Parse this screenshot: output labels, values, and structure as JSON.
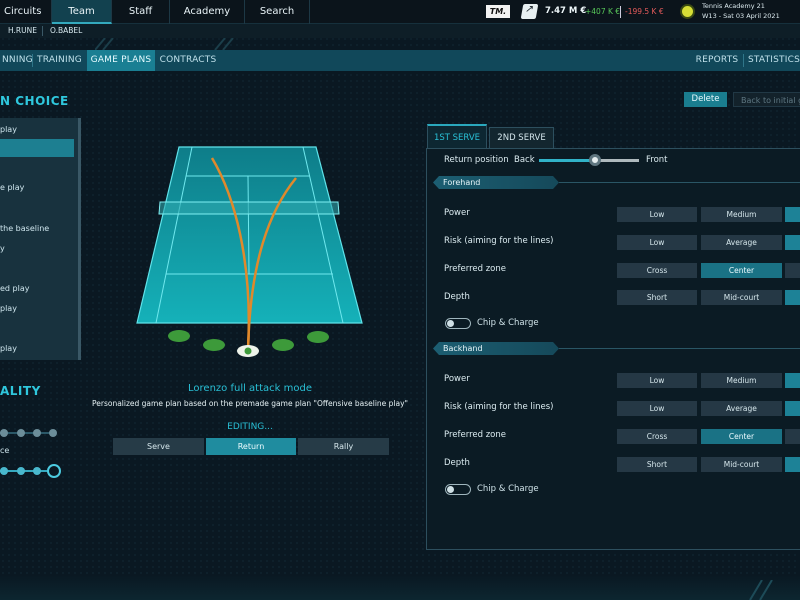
{
  "topnav": {
    "items": [
      "Circuits",
      "Team",
      "Staff",
      "Academy",
      "Search"
    ],
    "active": "Team",
    "tm_logo": "TM.",
    "balance": "7.47 M €",
    "income": "+407 K €",
    "expense": "-199.5 K €",
    "academy_name": "Tennis Academy 21",
    "date": "W13 - Sat 03 April 2021"
  },
  "players": [
    "H.RUNE",
    "O.BABEL"
  ],
  "tabs": {
    "left": [
      "NNING",
      "TRAINING",
      "GAME PLANS",
      "CONTRACTS"
    ],
    "right": [
      "REPORTS",
      "STATISTICS"
    ],
    "active": "GAME PLANS"
  },
  "left_section": {
    "title": "N CHOICE",
    "items": [
      " play",
      "",
      "e play",
      "",
      " the baseline",
      "y",
      "",
      "ed play",
      "play",
      "",
      "play"
    ],
    "selected_index": 1
  },
  "quality_section": {
    "title": "ALITY",
    "slider2_label": "ce"
  },
  "center": {
    "plan_name": "Lorenzo full attack mode",
    "plan_desc": "Personalized game plan based on the premade game plan \"Offensive baseline play\"",
    "editing": "EDITING...",
    "modes": [
      "Serve",
      "Return",
      "Rally"
    ],
    "active_mode": "Return"
  },
  "actions": {
    "delete": "Delete",
    "back": "Back to initial g"
  },
  "serve_tabs": [
    "1ST SERVE",
    "2ND SERVE"
  ],
  "return_position": {
    "label": "Return position",
    "left": "Back",
    "right": "Front",
    "value": 0.56
  },
  "forehand": {
    "header": "Forehand",
    "rows": [
      {
        "label": "Power",
        "options": [
          "Low",
          "Medium"
        ]
      },
      {
        "label": "Risk (aiming for the lines)",
        "options": [
          "Low",
          "Average"
        ]
      },
      {
        "label": "Preferred zone",
        "options": [
          "Cross",
          "Center"
        ],
        "active": "Center"
      },
      {
        "label": "Depth",
        "options": [
          "Short",
          "Mid-court"
        ]
      }
    ],
    "chip_label": "Chip & Charge"
  },
  "backhand": {
    "header": "Backhand",
    "rows": [
      {
        "label": "Power",
        "options": [
          "Low",
          "Medium"
        ]
      },
      {
        "label": "Risk (aiming for the lines)",
        "options": [
          "Low",
          "Average"
        ]
      },
      {
        "label": "Preferred zone",
        "options": [
          "Cross",
          "Center"
        ],
        "active": "Center"
      },
      {
        "label": "Depth",
        "options": [
          "Short",
          "Mid-court"
        ]
      }
    ],
    "chip_label": "Chip & Charge"
  },
  "colors": {
    "accent": "#29bfd5",
    "court": "#16a9b3",
    "trajectory": "#e0892b",
    "target": "#3d9a3a"
  }
}
